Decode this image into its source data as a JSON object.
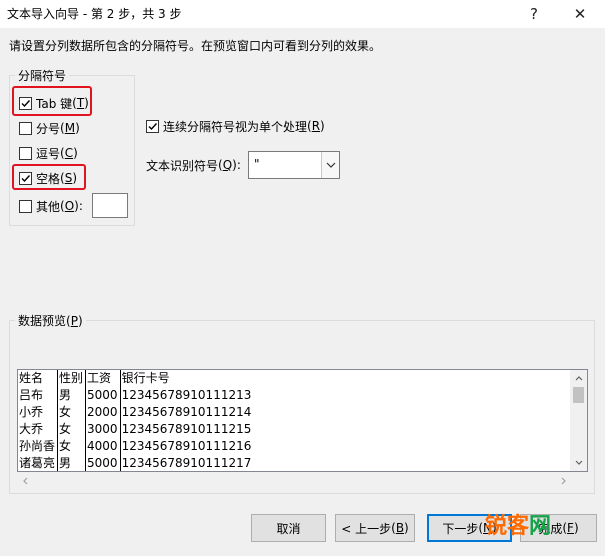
{
  "window": {
    "title": "文本导入向导 - 第 2 步，共 3 步",
    "help_glyph": "?",
    "close_glyph": "✕"
  },
  "instruction": "请设置分列数据所包含的分隔符号。在预览窗口内可看到分列的效果。",
  "delimiters": {
    "group_title": "分隔符号",
    "tab": {
      "label": "Tab 键",
      "hotkey": "T",
      "checked": true
    },
    "semicolon": {
      "label": "分号",
      "hotkey": "M",
      "checked": false
    },
    "comma": {
      "label": "逗号",
      "hotkey": "C",
      "checked": false
    },
    "space": {
      "label": "空格",
      "hotkey": "S",
      "checked": true
    },
    "other": {
      "label": "其他",
      "hotkey": "O",
      "suffix": ":",
      "checked": false,
      "value": ""
    }
  },
  "consecutive": {
    "label": "连续分隔符号视为单个处理",
    "hotkey": "R",
    "checked": true
  },
  "qualifier": {
    "label": "文本识别符号",
    "hotkey": "Q",
    "suffix": ":",
    "value": "\""
  },
  "preview": {
    "title": "数据预览",
    "hotkey": "P",
    "rows": [
      [
        "姓名",
        "性别",
        "工资",
        "银行卡号"
      ],
      [
        "吕布",
        "男",
        "5000",
        "12345678910111213"
      ],
      [
        "小乔",
        "女",
        "2000",
        "12345678910111214"
      ],
      [
        "大乔",
        "女",
        "3000",
        "12345678910111215"
      ],
      [
        "孙尚香",
        "女",
        "4000",
        "12345678910111216"
      ],
      [
        "诸葛亮",
        "男",
        "5000",
        "12345678910111217"
      ]
    ]
  },
  "buttons": {
    "cancel": "取消",
    "back": {
      "label": "< 上一步",
      "hotkey": "B"
    },
    "next": {
      "label": "下一步",
      "hotkey": "N"
    },
    "finish": {
      "label": "完成",
      "hotkey": "F"
    }
  },
  "watermark": {
    "part1": "锐客",
    "part2": "网"
  },
  "colors": {
    "highlight_red": "#e0141e",
    "focus_blue": "#0078d7"
  }
}
